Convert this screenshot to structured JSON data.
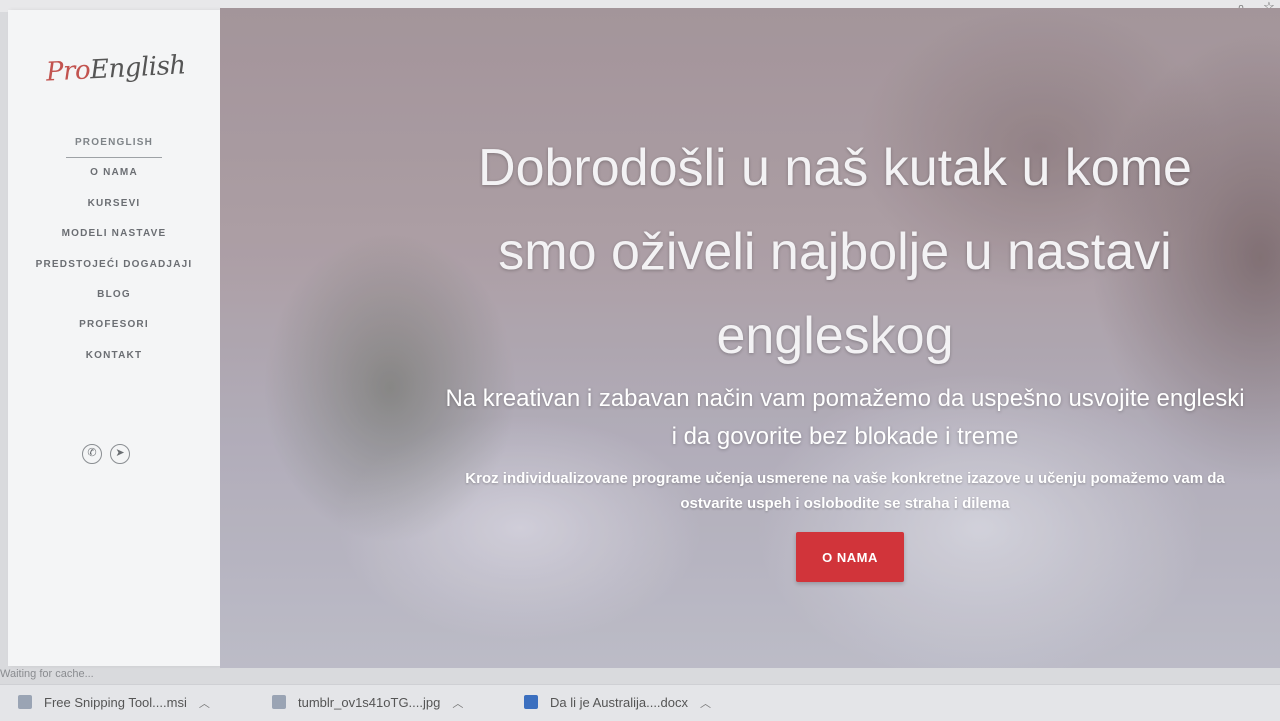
{
  "browser": {
    "search_icon": "magnifier-icon",
    "star_icon": "star-icon"
  },
  "sidebar": {
    "logo": {
      "part1": "Pro",
      "part2": "English"
    },
    "items": [
      {
        "label": "PROENGLISH"
      },
      {
        "label": "O NAMA"
      },
      {
        "label": "KURSEVI"
      },
      {
        "label": "MODELI NASTAVE"
      },
      {
        "label": "PREDSTOJEĆI DOGADJAJI"
      },
      {
        "label": "BLOG"
      },
      {
        "label": "PROFESORI"
      },
      {
        "label": "KONTAKT"
      }
    ],
    "social": [
      {
        "icon": "phone-icon",
        "glyph": "✆"
      },
      {
        "icon": "send-icon",
        "glyph": "➤"
      }
    ]
  },
  "hero": {
    "title": "Dobrodošli u naš kutak u kome smo oživeli najbolje u nastavi engleskog",
    "subtitle": "Na kreativan i zabavan način vam pomažemo da uspešno usvojite engleski i da govorite bez blokade i treme",
    "description": "Kroz individualizovane programe učenja usmerene na vaše konkretne izazove u učenju pomažemo vam da ostvarite uspeh i oslobodite se straha i dilema",
    "cta_label": "O NAMA"
  },
  "status_text": "Waiting for cache...",
  "downloads": [
    {
      "name": "Free Snipping Tool....msi"
    },
    {
      "name": "tumblr_ov1s41oTG....jpg"
    },
    {
      "name": "Da li je Australija....docx"
    }
  ],
  "colors": {
    "accent": "#d1343a",
    "logo_accent": "#c2534f"
  }
}
